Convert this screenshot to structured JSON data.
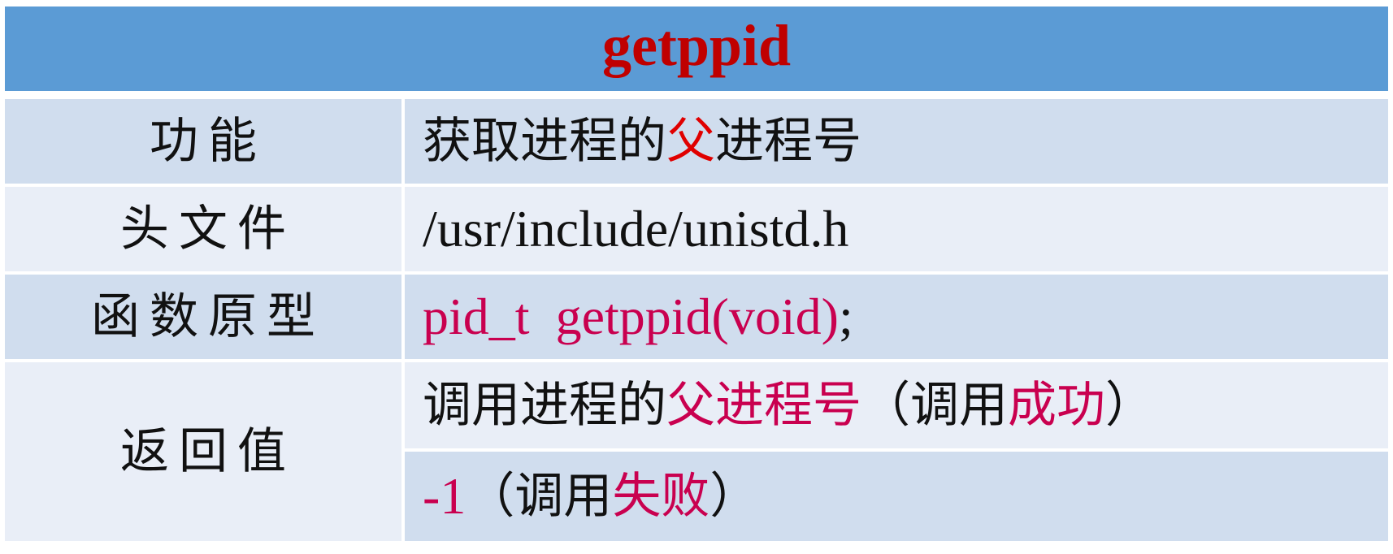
{
  "title": "getppid",
  "rows": {
    "function": {
      "label": "功能",
      "value_pre": "获取进程的",
      "value_hl": "父",
      "value_post": "进程号"
    },
    "header_file": {
      "label": "头文件",
      "value": "/usr/include/unistd.h"
    },
    "prototype": {
      "label": "函数原型",
      "value_colored": "pid_t  getppid(void)",
      "value_tail": ";"
    },
    "return_value": {
      "label": "返回值",
      "success": {
        "pre": "调用进程的",
        "hl1": "父进程号",
        "mid": "（调用",
        "hl2": "成功",
        "post": "）"
      },
      "failure": {
        "hl1": "-1",
        "mid": "（调用",
        "hl2": "失败",
        "post": "）"
      }
    }
  },
  "colors": {
    "header_bg": "#5b9bd5",
    "title": "#c00000",
    "dark_row": "#d0ddee",
    "light_row": "#e9eef7",
    "highlight_red": "#e00000",
    "highlight_magenta": "#c9004f"
  }
}
